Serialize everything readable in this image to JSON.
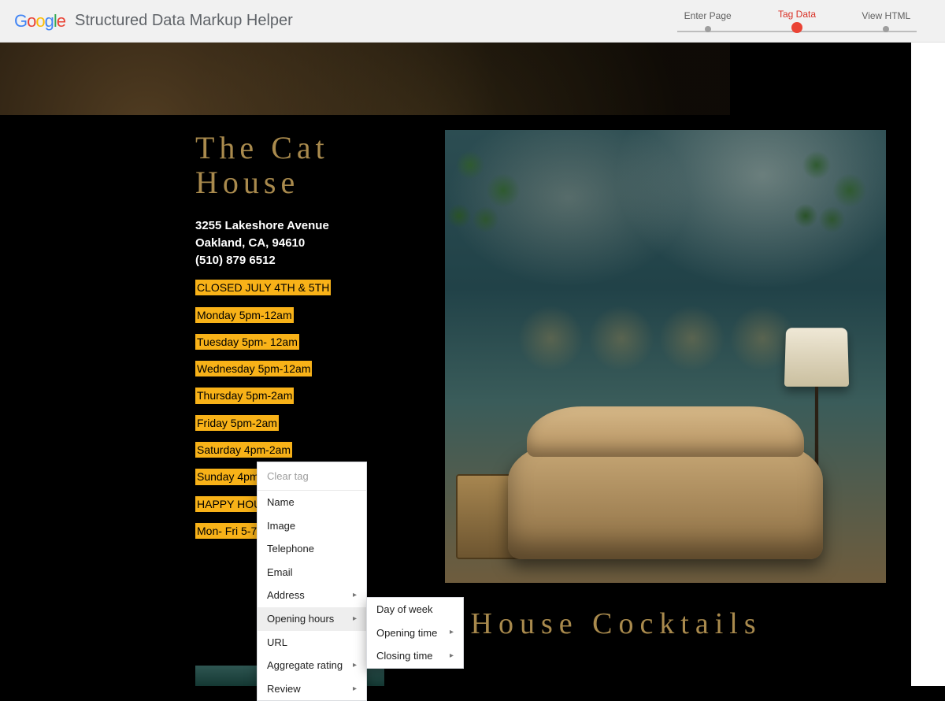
{
  "header": {
    "logo_text": "Google",
    "app_title": "Structured Data Markup Helper",
    "steps": [
      {
        "label": "Enter Page",
        "active": false
      },
      {
        "label": "Tag Data",
        "active": true
      },
      {
        "label": "View HTML",
        "active": false
      }
    ]
  },
  "business": {
    "name": "The Cat House",
    "address_line1": "3255 Lakeshore Avenue",
    "address_line2": "Oakland, CA, 94610",
    "phone": "(510) 879 6512",
    "notice": "CLOSED JULY 4TH & 5TH",
    "hours": [
      "Monday 5pm-12am",
      "Tuesday 5pm- 12am",
      "Wednesday 5pm-12am",
      "Thursday 5pm-2am",
      "Friday 5pm-2am",
      "Saturday 4pm-2am",
      "Sunday 4pm-"
    ],
    "happy_hour_label": "HAPPY HOU",
    "happy_hour_times": "Mon- Fri 5-7",
    "section_heading_right": "d House Cocktails"
  },
  "context_menu": {
    "clear_label": "Clear tag",
    "items": [
      {
        "label": "Name",
        "submenu": false
      },
      {
        "label": "Image",
        "submenu": false
      },
      {
        "label": "Telephone",
        "submenu": false
      },
      {
        "label": "Email",
        "submenu": false
      },
      {
        "label": "Address",
        "submenu": true
      },
      {
        "label": "Opening hours",
        "submenu": true,
        "hovered": true
      },
      {
        "label": "URL",
        "submenu": false
      },
      {
        "label": "Aggregate rating",
        "submenu": true
      },
      {
        "label": "Review",
        "submenu": true
      }
    ],
    "submenu_opening_hours": [
      {
        "label": "Day of week",
        "submenu": false
      },
      {
        "label": "Opening time",
        "submenu": true
      },
      {
        "label": "Closing time",
        "submenu": true
      }
    ]
  }
}
